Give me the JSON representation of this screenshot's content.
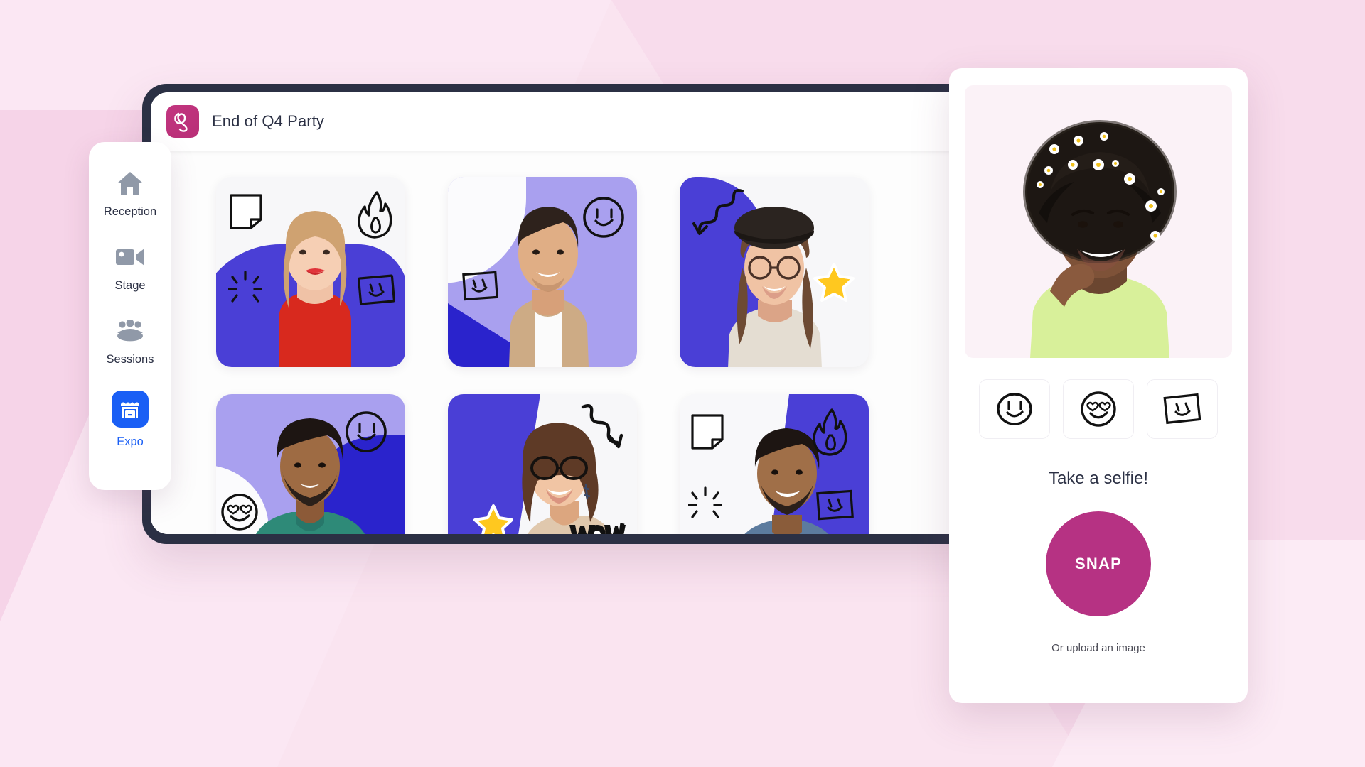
{
  "app": {
    "title": "End of Q4 Party",
    "logo_icon": "swirl-logo-icon",
    "logo_color": "#b82f77"
  },
  "sidebar": {
    "items": [
      {
        "label": "Reception",
        "icon": "home-icon",
        "active": false
      },
      {
        "label": "Stage",
        "icon": "video-camera-icon",
        "active": false
      },
      {
        "label": "Sessions",
        "icon": "people-group-icon",
        "active": false
      },
      {
        "label": "Expo",
        "icon": "expo-booth-icon",
        "active": true
      }
    ],
    "active_color": "#1a5ff5"
  },
  "gallery": {
    "cards": [
      {
        "name": "photo-card-1",
        "bg": "#f7f7f9",
        "blob_color": "#4a3fd6",
        "stickers": [
          "note-icon",
          "flame-icon",
          "sparkle-burst-icon",
          "square-face-icon"
        ]
      },
      {
        "name": "photo-card-2",
        "bg": "#a9a0ef",
        "blob_color": "#2a23cc",
        "stickers": [
          "circle-smiley-icon",
          "square-face-icon"
        ]
      },
      {
        "name": "photo-card-3",
        "bg": "#f7f7f9",
        "blob_color": "#4a3fd6",
        "stickers": [
          "squiggle-arrow-icon",
          "star-icon"
        ]
      },
      {
        "name": "photo-card-4",
        "bg": "#a9a0ef",
        "blob_color": "#2a23cc",
        "stickers": [
          "circle-smiley-icon",
          "heart-eyes-smiley-icon"
        ]
      },
      {
        "name": "photo-card-5",
        "bg": "#f7f7f9",
        "blob_color": "#4a3fd6",
        "stickers": [
          "squiggle-arrow-icon",
          "star-icon",
          "wow-text-icon"
        ]
      },
      {
        "name": "photo-card-6",
        "bg": "#f7f7f9",
        "blob_color": "#4a3fd6",
        "stickers": [
          "note-icon",
          "flame-icon",
          "sparkle-burst-icon",
          "square-face-icon"
        ]
      }
    ]
  },
  "selfie": {
    "preview_alt": "selfie-preview",
    "stickers": [
      {
        "name": "sticker-option-smiley",
        "icon": "circle-smiley-icon"
      },
      {
        "name": "sticker-option-heart-eyes",
        "icon": "heart-eyes-smiley-icon"
      },
      {
        "name": "sticker-option-square-face",
        "icon": "square-face-icon"
      }
    ],
    "caption": "Take a selfie!",
    "snap_label": "SNAP",
    "snap_color": "#b63283",
    "upload_label": "Or upload an image"
  },
  "colors": {
    "page_bg": "#fae4f0",
    "bezel": "#2b3044",
    "blue_accent": "#4a3fd6",
    "yellow_star": "#ffc81f"
  }
}
